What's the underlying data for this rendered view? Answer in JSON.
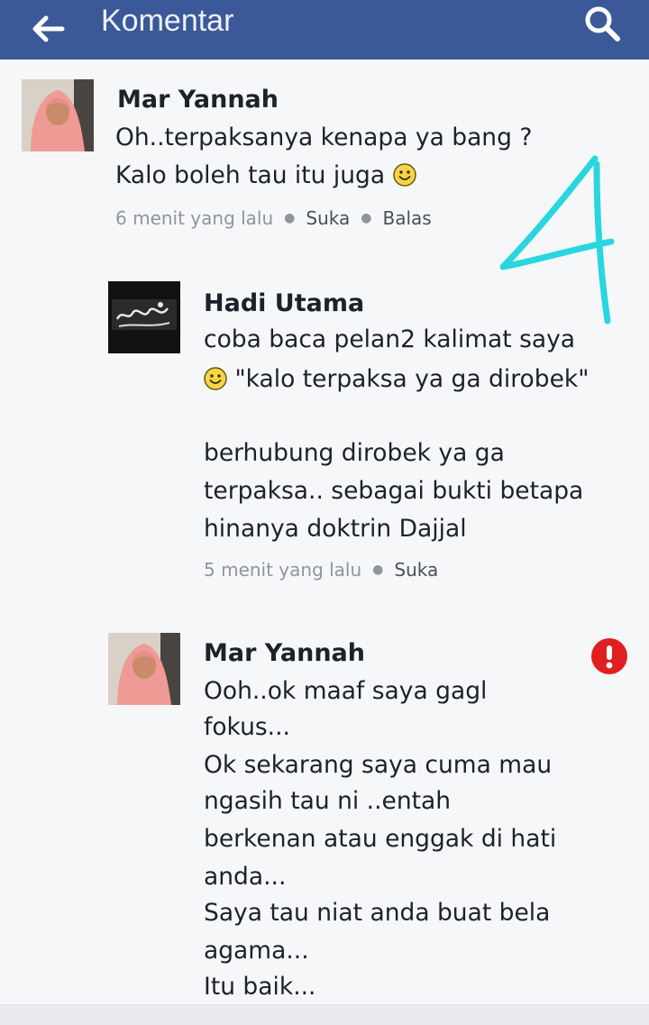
{
  "header": {
    "title": "Komentar",
    "back_icon": "arrow-left-icon",
    "search_icon": "search-icon",
    "background": "#3b5998"
  },
  "comments": [
    {
      "author": "Mar Yannah",
      "lines": [
        "Oh..terpaksanya kenapa ya bang ?",
        "Kalo boleh tau itu juga"
      ],
      "time": "6 menit yang lalu",
      "like": "Suka",
      "reply": "Balas"
    },
    {
      "author": "Hadi Utama",
      "lines": [
        "coba baca pelan2 kalimat saya",
        "\"kalo terpaksa ya ga dirobek\"",
        "berhubung dirobek ya ga",
        "terpaksa.. sebagai bukti betapa",
        "hinanya doktrin Dajjal"
      ],
      "time": "5 menit yang lalu",
      "like": "Suka"
    },
    {
      "author": "Mar Yannah",
      "lines": [
        "Ooh..ok maaf saya gagl",
        "fokus...",
        "Ok sekarang saya cuma mau",
        "ngasih tau ni ..entah",
        "berkenan atau enggak di hati",
        "anda...",
        "Saya tau niat anda buat bela",
        "agama...",
        "Itu baik..."
      ]
    }
  ],
  "annotation": {
    "text": "4",
    "color": "#29d6e0"
  },
  "alert": {
    "icon": "exclamation-icon",
    "color": "#e02020"
  }
}
